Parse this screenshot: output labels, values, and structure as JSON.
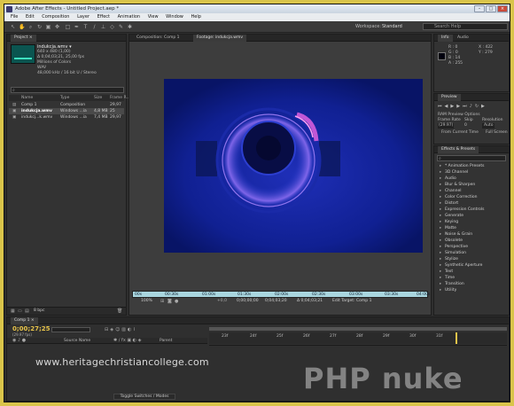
{
  "window": {
    "title": "Adobe After Effects - Untitled Project.aep *"
  },
  "menu": [
    "File",
    "Edit",
    "Composition",
    "Layer",
    "Effect",
    "Animation",
    "View",
    "Window",
    "Help"
  ],
  "toolbar": {
    "workspace_label": "Workspace:",
    "workspace_value": "Standard",
    "search_placeholder": "Search Help"
  },
  "project": {
    "tab": "Project ×",
    "file_name": "indukcja.wmv ▾",
    "info": [
      "640 x 480 (1,00)",
      "Δ 0;04;03;21, 25,00 fps",
      "Millions of Colors",
      "WAV",
      "48,000 kHz / 16 bit U / Stereo"
    ],
    "columns": [
      "Name",
      "Type",
      "Size",
      "Frame R..."
    ],
    "items": [
      {
        "name": "Comp 1",
        "type": "Composition",
        "size": "",
        "fr": "29,97"
      },
      {
        "name": "indukcja.wmv",
        "type": "Windows ...ia",
        "size": "4,8 MB",
        "fr": "25"
      },
      {
        "name": "indukcj...k.wmv",
        "type": "Windows ...ia",
        "size": "7,4 MB",
        "fr": "29,97"
      }
    ],
    "bpc": "8 bpc"
  },
  "viewer": {
    "tab_comp": "Composition: Comp 1",
    "tab_footage": "Footage: indukcja.wmv",
    "ruler": [
      "00s",
      "00:30s",
      "01:00s",
      "01:30s",
      "02:00s",
      "02:30s",
      "03:00s",
      "03:30s",
      "04:00s"
    ],
    "zoom": "100%",
    "time1": "0;00;00;00",
    "time2": "0;04;03;20",
    "time3": "Δ 0;04;03;21",
    "add_label": "+0,0",
    "target": "Edit Target: Comp 1"
  },
  "info_panel": {
    "tabs": [
      "Info",
      "Audio"
    ],
    "r": "R : 0",
    "g": "G : 0",
    "b": "B : 14",
    "a": "A : 255",
    "x": "X : 422",
    "y": "Y : 279",
    "swatch_color": "#00000e"
  },
  "preview": {
    "tab": "Preview",
    "ram": "RAM Preview Options",
    "labels": [
      "Frame Rate",
      "Skip",
      "Resolution"
    ],
    "values": [
      "(29.97)",
      "0",
      "Auto"
    ],
    "from_current": "From Current Time",
    "full_screen": "Full Screen"
  },
  "effects": {
    "tab": "Effects & Presets",
    "search_placeholder": "",
    "items": [
      "* Animation Presets",
      "3D Channel",
      "Audio",
      "Blur & Sharpen",
      "Channel",
      "Color Correction",
      "Distort",
      "Expression Controls",
      "Generate",
      "Keying",
      "Matte",
      "Noise & Grain",
      "Obsolete",
      "Perspective",
      "Simulation",
      "Stylize",
      "Synthetic Aperture",
      "Text",
      "Time",
      "Transition",
      "Utility"
    ]
  },
  "timeline": {
    "tab": "Comp 1 ×",
    "timecode": "0;00;27;25",
    "frames": "(29.97 fps)",
    "col_source": "Source Name",
    "col_parent": "Parent",
    "ticks": [
      "23f",
      "24f",
      "25f",
      "26f",
      "27f",
      "28f",
      "29f",
      "30f",
      "31f"
    ],
    "toggle": "Toggle Switches / Modes"
  },
  "watermarks": {
    "left": "www.heritagechristiancollege.com",
    "right": "PHP nuke"
  }
}
